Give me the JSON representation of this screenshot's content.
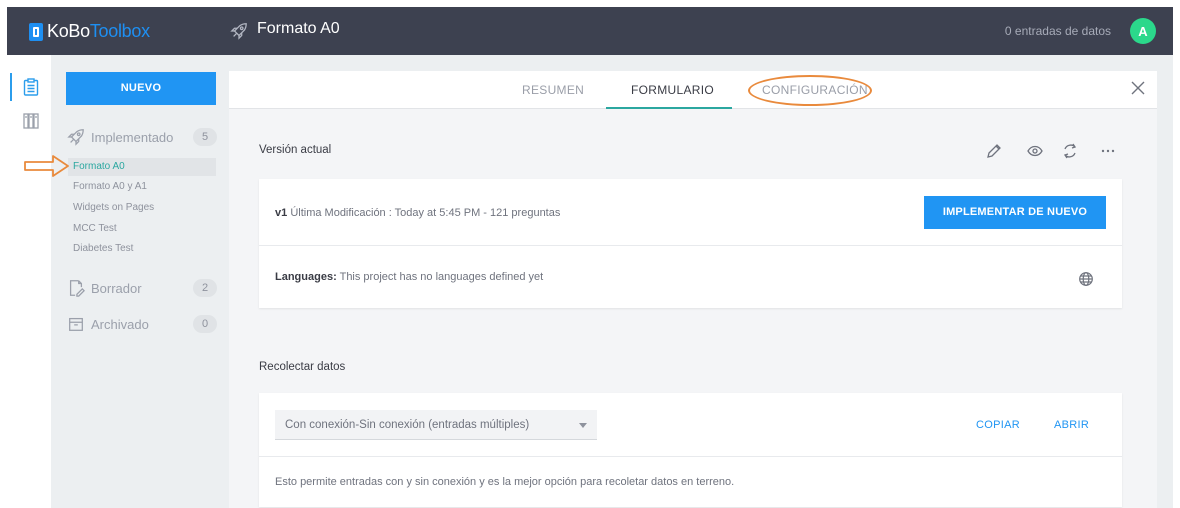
{
  "header": {
    "logo_ko": "KoBo",
    "logo_toolbox": "Toolbox",
    "project_title": "Formato A0",
    "entries": "0 entradas de datos",
    "avatar_letter": "A"
  },
  "sidebar": {
    "new_button": "NUEVO",
    "groups": [
      {
        "label": "Implementado",
        "count": "5",
        "icon": "rocket-icon"
      },
      {
        "label": "Borrador",
        "count": "2",
        "icon": "draft-icon"
      },
      {
        "label": "Archivado",
        "count": "0",
        "icon": "archive-icon"
      }
    ],
    "deployed_items": [
      "Formato A0",
      "Formato A0 y A1",
      "Widgets on Pages",
      "MCC Test",
      "Diabetes Test"
    ]
  },
  "tabs": [
    "RESUMEN",
    "FORMULARIO",
    "CONFIGURACIÓN"
  ],
  "current_version": {
    "title": "Versión actual",
    "version": "v1",
    "modified": "Última Modificación : Today at 5:45 PM - 121 preguntas",
    "redeploy_button": "IMPLEMENTAR DE NUEVO",
    "languages_label": "Languages:",
    "languages_value": "This project has no languages defined yet"
  },
  "collect": {
    "title": "Recolectar datos",
    "select_value": "Con conexión-Sin conexión (entradas múltiples)",
    "copy_button": "COPIAR",
    "open_button": "ABRIR",
    "description": "Esto permite entradas con y sin conexión y es la mejor opción para recoletar datos en terreno."
  },
  "colors": {
    "topbar": "#3d4150",
    "primary": "#2095f3",
    "teal": "#2ba7a0",
    "annotation": "#e98a3c",
    "avatar": "#2bd88b"
  }
}
